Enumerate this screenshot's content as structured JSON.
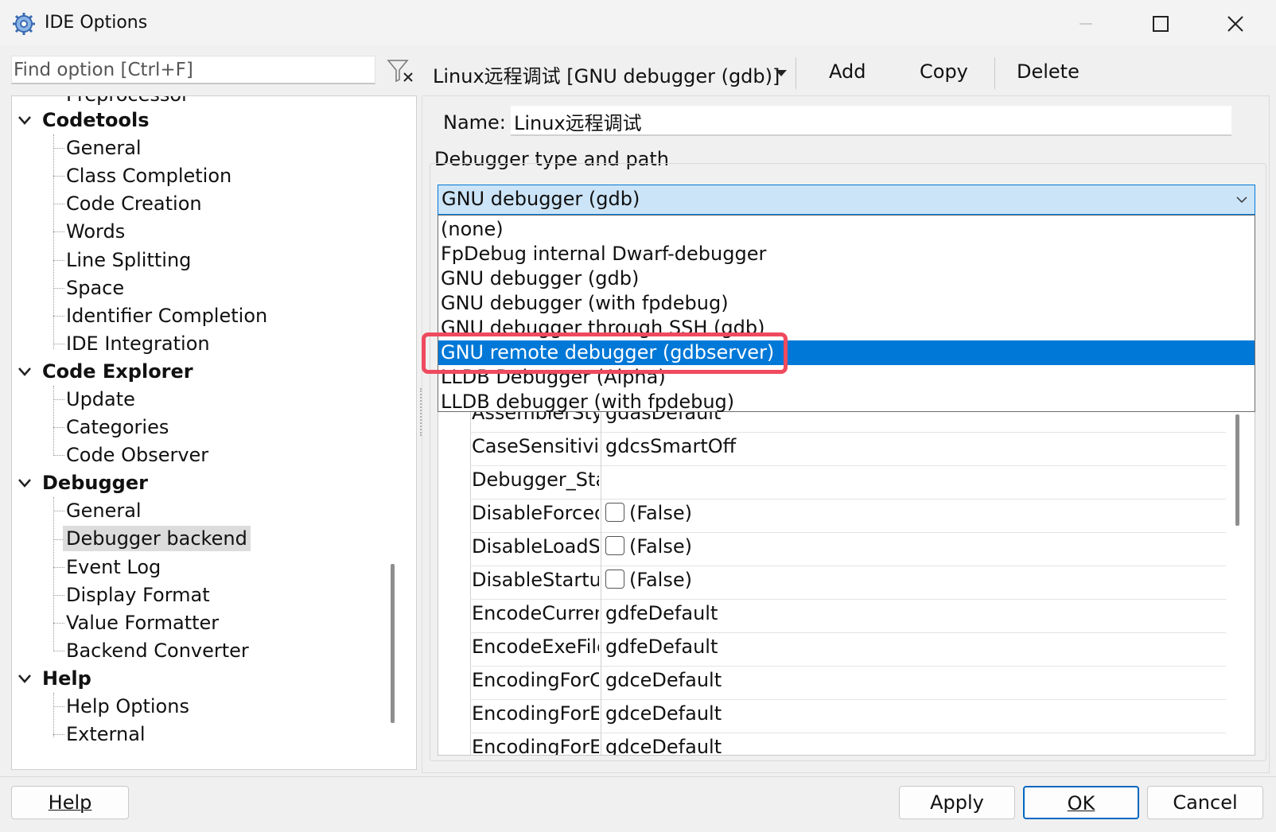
{
  "window": {
    "title": "IDE Options"
  },
  "search": {
    "placeholder": "Find option [Ctrl+F]"
  },
  "tree": {
    "partial_top": "Preprocessor",
    "codetools": {
      "label": "Codetools",
      "children": [
        "General",
        "Class Completion",
        "Code Creation",
        "Words",
        "Line Splitting",
        "Space",
        "Identifier Completion",
        "IDE Integration"
      ]
    },
    "code_explorer": {
      "label": "Code Explorer",
      "children": [
        "Update",
        "Categories",
        "Code Observer"
      ]
    },
    "debugger": {
      "label": "Debugger",
      "children": [
        "General",
        "Debugger backend",
        "Event Log",
        "Display Format",
        "Value Formatter",
        "Backend Converter"
      ],
      "selected": "Debugger backend"
    },
    "help": {
      "label": "Help",
      "children": [
        "Help Options",
        "External"
      ]
    }
  },
  "toolbar": {
    "profile": "Linux远程调试 [GNU debugger (gdb)]",
    "add": "Add",
    "copy": "Copy",
    "delete": "Delete"
  },
  "name": {
    "label": "Name:",
    "value": "Linux远程调试"
  },
  "debugger_group": {
    "label": "Debugger type and path"
  },
  "combo": {
    "value": "GNU debugger (gdb)"
  },
  "dropdown": {
    "options": [
      "(none)",
      "FpDebug internal Dwarf-debugger",
      "GNU debugger (gdb)",
      "GNU debugger (with fpdebug)",
      "GNU debugger through SSH (gdb)",
      "GNU remote debugger (gdbserver)",
      "LLDB Debugger (Alpha)",
      "LLDB debugger (with fpdebug)"
    ],
    "highlighted": "GNU remote debugger (gdbserver)"
  },
  "properties": [
    {
      "name": "AssemblerStyle",
      "value": "gdasDefault"
    },
    {
      "name": "CaseSensitivity",
      "value": "gdcsSmartOff"
    },
    {
      "name": "Debugger_Startup",
      "value": ""
    },
    {
      "name": "DisableForcedBreakpoint",
      "value": "(False)",
      "checkbox": true
    },
    {
      "name": "DisableLoadSymbols",
      "value": "(False)",
      "checkbox": true
    },
    {
      "name": "DisableStartupShell",
      "value": "(False)",
      "checkbox": true
    },
    {
      "name": "EncodeCurrentDir",
      "value": "gdfeDefault"
    },
    {
      "name": "EncodeExeFile",
      "value": "gdfeDefault"
    },
    {
      "name": "EncodingForCurrentDir",
      "value": "gdceDefault"
    },
    {
      "name": "EncodingForExeFile",
      "value": "gdceDefault"
    },
    {
      "name": "EncodingForEnvironment",
      "value": "gdceDefault"
    }
  ],
  "buttons": {
    "help": "Help",
    "apply": "Apply",
    "ok": "OK",
    "cancel": "Cancel"
  },
  "colors": {
    "accent": "#0078d7",
    "callout": "#ef4a5e",
    "combo_bg": "#cce4f7"
  }
}
